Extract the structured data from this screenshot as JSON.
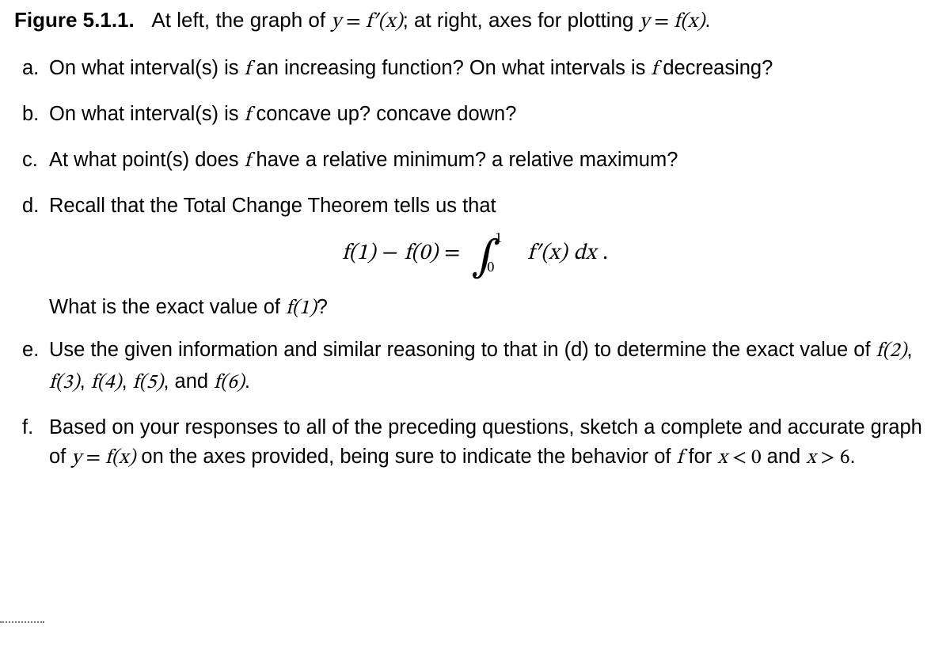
{
  "figure": {
    "label": "Figure 5.1.1.",
    "caption_pre": "At left, the graph of ",
    "caption_eq1_lhs": "y",
    "caption_eq1_eq": " = ",
    "caption_eq1_rhs": "f′(x)",
    "caption_mid": "; at right, axes for plotting ",
    "caption_eq2_lhs": "y",
    "caption_eq2_eq": " = ",
    "caption_eq2_rhs": "f(x)",
    "caption_end": "."
  },
  "items": {
    "a": {
      "marker": "a.",
      "t1": "On what interval(s) is ",
      "f1": "f",
      "t2": " an increasing function? On what intervals is ",
      "f2": "f",
      "t3": " decreasing?"
    },
    "b": {
      "marker": "b.",
      "t1": "On what interval(s) is ",
      "f1": "f",
      "t2": " concave up? concave down?"
    },
    "c": {
      "marker": "c.",
      "t1": "At what point(s) does ",
      "f1": "f",
      "t2": " have a relative minimum? a relative maximum?"
    },
    "d": {
      "marker": "d.",
      "t1": "Recall that the Total Change Theorem tells us that"
    },
    "d_eq": {
      "lhs1": "f(1)",
      "minus": " − ",
      "lhs2": "f(0)",
      "eq": " = ",
      "int_upper": "1",
      "int_lower": "0",
      "integrand": "f′(x)",
      "dx": " dx",
      "period": "."
    },
    "d_follow": {
      "t1": "What is the exact value of ",
      "f1": "f(1)",
      "t2": "?"
    },
    "e": {
      "marker": "e.",
      "t1": "Use the given information and similar reasoning to that in (d) to determine the exact value of ",
      "v1": "f(2)",
      "c1": ", ",
      "v2": "f(3)",
      "c2": ", ",
      "v3": "f(4)",
      "c3": ", ",
      "v4": "f(5)",
      "c4": ", and ",
      "v5": "f(6)",
      "c5": "."
    },
    "f": {
      "marker": "f.",
      "t1": "Based on your responses to all of the preceding questions, sketch a complete and accurate graph of ",
      "eq_lhs": "y",
      "eq_eq": " = ",
      "eq_rhs": "f(x)",
      "t2": " on the axes provided, being sure to indicate the behavior of ",
      "f1": "f",
      "t3": " for ",
      "cond1_lhs": "x",
      "cond1_op": " < ",
      "cond1_rhs": "0",
      "t4": " and ",
      "cond2_lhs": "x",
      "cond2_op": " > ",
      "cond2_rhs": "6",
      "t5": "."
    }
  }
}
